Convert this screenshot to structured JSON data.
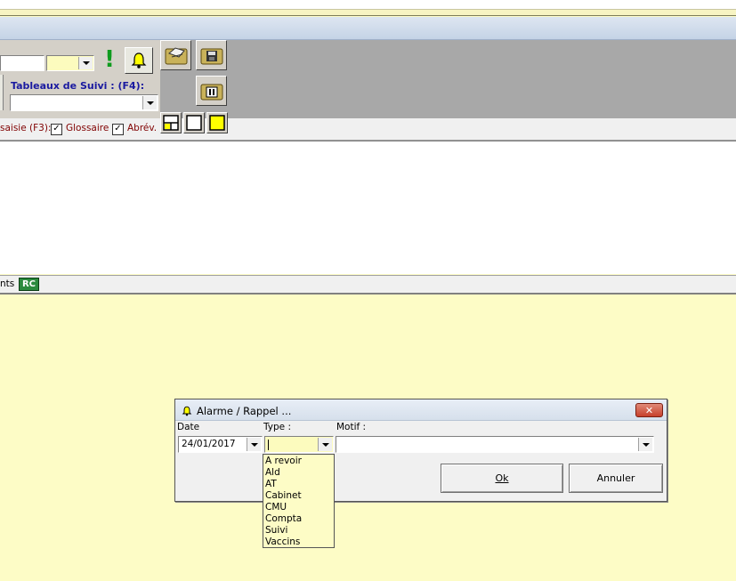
{
  "toolbar": {
    "tableaux_label": "Tableaux de Suivi : (F4):",
    "saisie_label": "saisie (F3):",
    "glossaire_label": "Glossaire",
    "abrev_label": "Abrév.",
    "exclaim_symbol": "!"
  },
  "status_strip": {
    "left_text": "nts",
    "rc_badge": "RC"
  },
  "dialog": {
    "title": "Alarme / Rappel ...",
    "date_label": "Date",
    "type_label": "Type :",
    "motif_label": "Motif :",
    "date_value": "24/01/2017",
    "type_value": "",
    "motif_value": "",
    "ok_label": "Ok",
    "cancel_label": "Annuler",
    "close_symbol": "✕",
    "type_options": [
      "A revoir",
      "Ald",
      "AT",
      "Cabinet",
      "CMU",
      "Compta",
      "Suivi",
      "Vaccins"
    ]
  },
  "colors": {
    "background": "#fdfcc6",
    "toolbar_gray": "#a8a8a8",
    "label_blue": "#1a1aa0",
    "label_darkred": "#800000",
    "rc_green": "#2b8a3e",
    "close_red": "#c7402b"
  }
}
